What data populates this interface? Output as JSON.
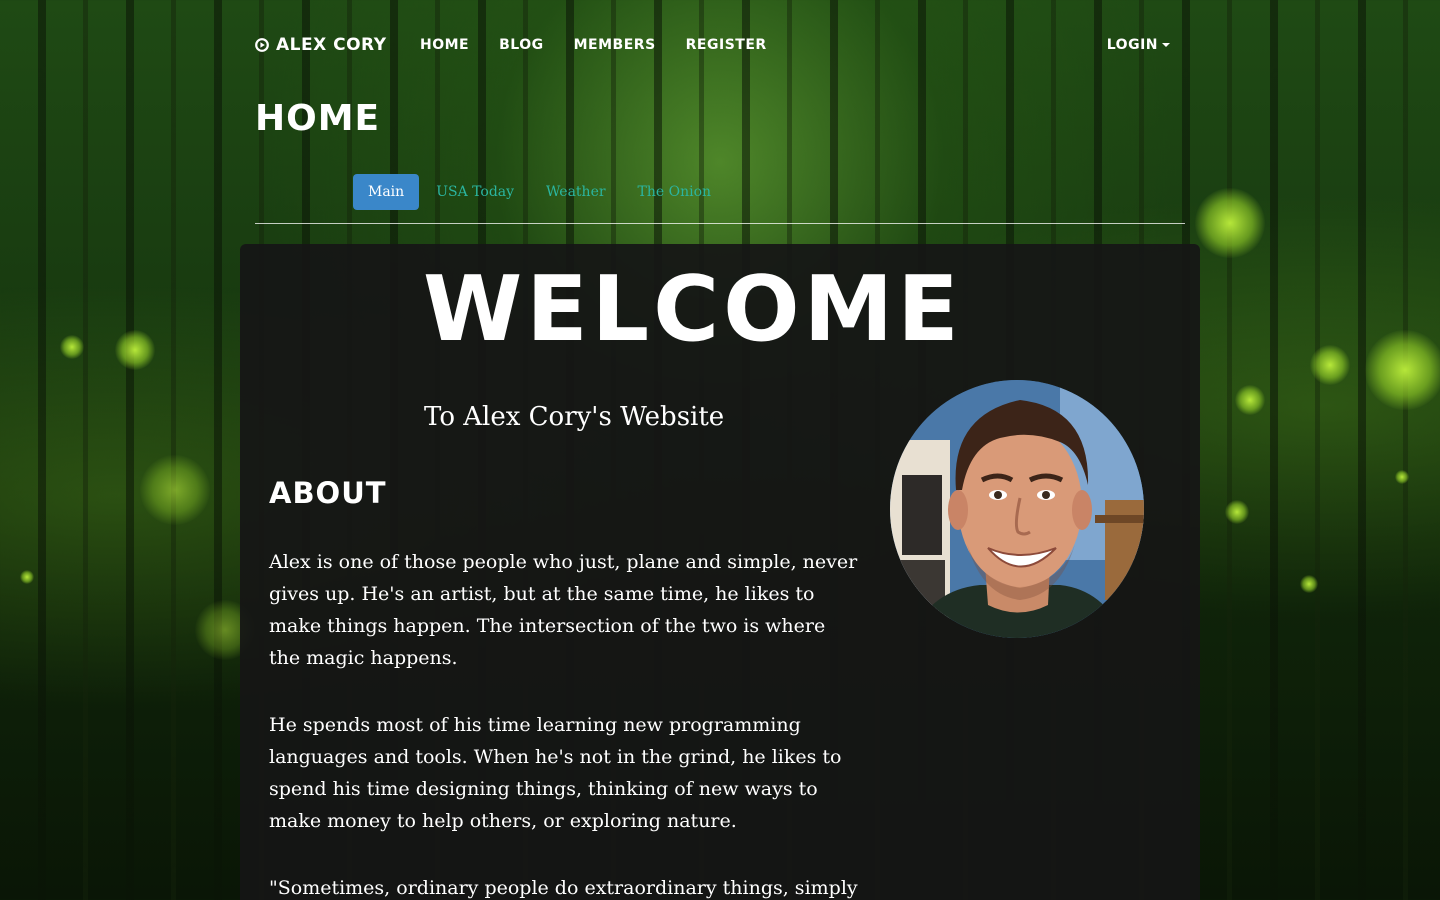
{
  "navbar": {
    "brand": "ALEX CORY",
    "links": [
      "HOME",
      "BLOG",
      "MEMBERS",
      "REGISTER"
    ],
    "login": "LOGIN"
  },
  "page_title": "HOME",
  "tabs": [
    {
      "label": "Main",
      "active": true
    },
    {
      "label": "USA Today",
      "active": false
    },
    {
      "label": "Weather",
      "active": false
    },
    {
      "label": "The Onion",
      "active": false
    }
  ],
  "main": {
    "welcome": "WELCOME",
    "subtitle": "To Alex Cory's Website",
    "about_heading": "ABOUT",
    "paragraphs": [
      "Alex is one of those people who just, plane and simple, never gives up. He's an artist, but at the same time, he likes to make things happen. The intersection of the two is where the magic happens.",
      "He spends most of his time learning new programming languages and tools. When he's not in the grind, he likes to spend his time designing things, thinking of new ways to make money to help others, or exploring nature.",
      "\"Sometimes, ordinary people do extraordinary things, simply"
    ]
  },
  "icons": {
    "brand": "play-circle-icon",
    "login_caret": "caret-down-icon"
  },
  "colors": {
    "active_tab": "#3a87c9",
    "tab_link": "#2bb5a0",
    "panel_bg": "#161616",
    "firefly": "#c4f03a"
  }
}
